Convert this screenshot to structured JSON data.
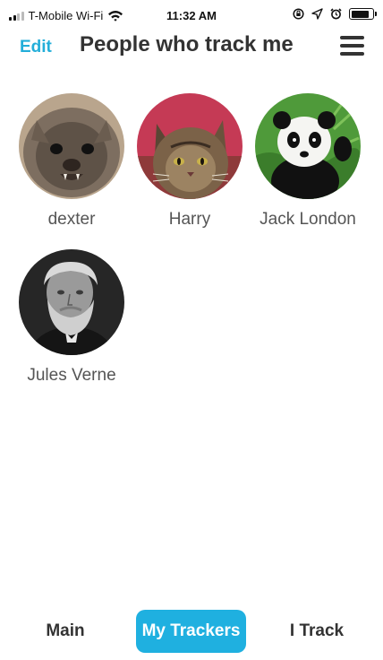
{
  "status_bar": {
    "carrier": "T-Mobile Wi-Fi",
    "time": "11:32 AM",
    "battery_level": 0.85
  },
  "header": {
    "edit_label": "Edit",
    "title": "People who track me"
  },
  "trackers": [
    {
      "name": "dexter",
      "avatar": "bat-photo"
    },
    {
      "name": "Harry",
      "avatar": "cat-photo"
    },
    {
      "name": "Jack London",
      "avatar": "panda-photo"
    },
    {
      "name": "Jules Verne",
      "avatar": "portrait-photo"
    }
  ],
  "tabs": [
    {
      "label": "Main",
      "active": false
    },
    {
      "label": "My Trackers",
      "active": true
    },
    {
      "label": "I Track",
      "active": false
    }
  ],
  "colors": {
    "accent": "#23aed9",
    "active_tab": "#1fb0e0"
  }
}
